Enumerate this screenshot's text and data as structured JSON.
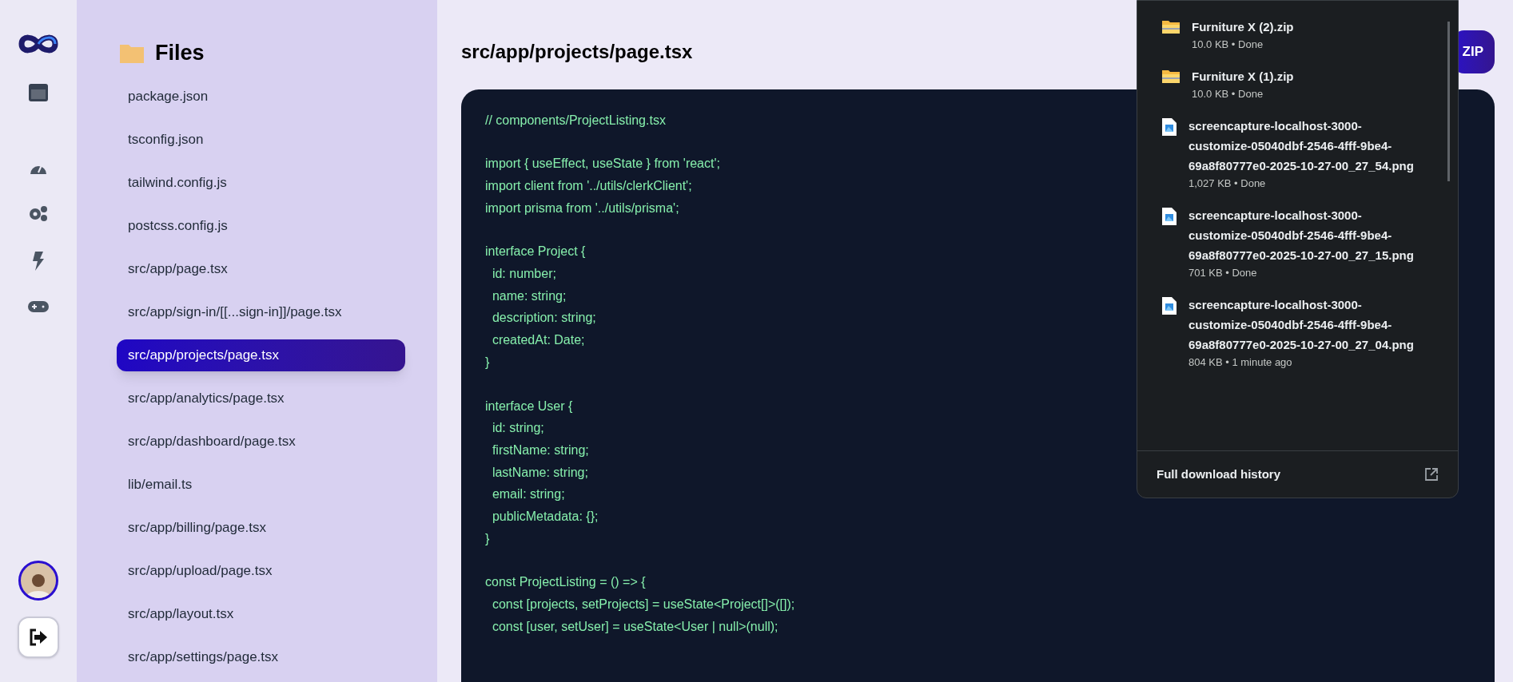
{
  "rail": {
    "items": [
      {
        "kind": "panel"
      },
      {
        "kind": "gauge"
      },
      {
        "kind": "gears"
      },
      {
        "kind": "bolt"
      },
      {
        "kind": "gamepad"
      }
    ]
  },
  "files": {
    "title": "Files",
    "items": [
      {
        "label": "package.json",
        "selected": false
      },
      {
        "label": "tsconfig.json",
        "selected": false
      },
      {
        "label": "tailwind.config.js",
        "selected": false
      },
      {
        "label": "postcss.config.js",
        "selected": false
      },
      {
        "label": "src/app/page.tsx",
        "selected": false
      },
      {
        "label": "src/app/sign-in/[[...sign-in]]/page.tsx",
        "selected": false
      },
      {
        "label": "src/app/projects/page.tsx",
        "selected": true
      },
      {
        "label": "src/app/analytics/page.tsx",
        "selected": false
      },
      {
        "label": "src/app/dashboard/page.tsx",
        "selected": false
      },
      {
        "label": "lib/email.ts",
        "selected": false
      },
      {
        "label": "src/app/billing/page.tsx",
        "selected": false
      },
      {
        "label": "src/app/upload/page.tsx",
        "selected": false
      },
      {
        "label": "src/app/layout.tsx",
        "selected": false
      },
      {
        "label": "src/app/settings/page.tsx",
        "selected": false
      }
    ]
  },
  "editor": {
    "title": "src/app/projects/page.tsx",
    "download_button": "ZIP",
    "code_blocks": [
      [
        "// components/ProjectListing.tsx"
      ],
      [
        "import { useEffect, useState } from 'react';",
        "import client from '../utils/clerkClient';",
        "import prisma from '../utils/prisma';"
      ],
      [
        "interface Project {",
        "  id: number;",
        "  name: string;",
        "  description: string;",
        "  createdAt: Date;",
        "}"
      ],
      [
        "interface User {",
        "  id: string;",
        "  firstName: string;",
        "  lastName: string;",
        "  email: string;",
        "  publicMetadata: {};",
        "}"
      ],
      [
        "const ProjectListing = () => {",
        "  const [projects, setProjects] = useState<Project[]>([]);",
        "  const [user, setUser] = useState<User | null>(null);"
      ]
    ]
  },
  "downloads": {
    "items": [
      {
        "kind": "zip",
        "name": "Furniture X (2).zip",
        "status": "10.0 KB • Done"
      },
      {
        "kind": "zip",
        "name": "Furniture X (1).zip",
        "status": "10.0 KB • Done"
      },
      {
        "kind": "image",
        "name": "screencapture-localhost-3000-customize-05040dbf-2546-4fff-9be4-69a8f80777e0-2025-10-27-00_27_54.png",
        "status": "1,027 KB • Done"
      },
      {
        "kind": "image",
        "name": "screencapture-localhost-3000-customize-05040dbf-2546-4fff-9be4-69a8f80777e0-2025-10-27-00_27_15.png",
        "status": "701 KB • Done"
      },
      {
        "kind": "image",
        "name": "screencapture-localhost-3000-customize-05040dbf-2546-4fff-9be4-69a8f80777e0-2025-10-27-00_27_04.png",
        "status": "804 KB • 1 minute ago"
      }
    ],
    "footer": "Full download history"
  }
}
